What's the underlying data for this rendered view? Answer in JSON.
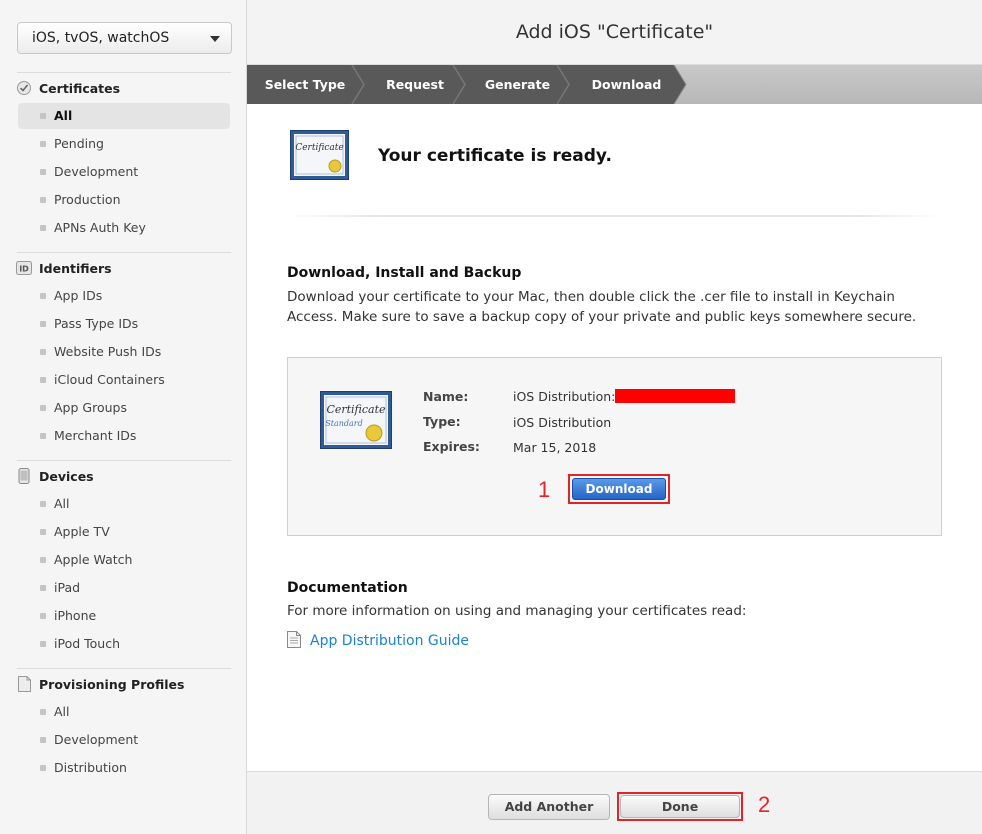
{
  "sidebar": {
    "platform_select": "iOS, tvOS, watchOS",
    "sections": [
      {
        "title": "Certificates",
        "icon": "certificate-icon",
        "items": [
          "All",
          "Pending",
          "Development",
          "Production",
          "APNs Auth Key"
        ]
      },
      {
        "title": "Identifiers",
        "icon": "id-icon",
        "icon_text": "ID",
        "items": [
          "App IDs",
          "Pass Type IDs",
          "Website Push IDs",
          "iCloud Containers",
          "App Groups",
          "Merchant IDs"
        ]
      },
      {
        "title": "Devices",
        "icon": "device-icon",
        "items": [
          "All",
          "Apple TV",
          "Apple Watch",
          "iPad",
          "iPhone",
          "iPod Touch"
        ]
      },
      {
        "title": "Provisioning Profiles",
        "icon": "document-icon",
        "items": [
          "All",
          "Development",
          "Distribution"
        ]
      }
    ],
    "active_item": "Certificates/All"
  },
  "header": {
    "title": "Add iOS \"Certificate\""
  },
  "steps": [
    "Select Type",
    "Request",
    "Generate",
    "Download"
  ],
  "content": {
    "cert_text": "Certificate",
    "cert_sub": "Standard",
    "ready_text": "Your certificate is ready.",
    "backup_heading": "Download, Install and Backup",
    "backup_para": "Download your certificate to your Mac, then double click the .cer file to install in Keychain Access. Make sure to save a backup copy of your private and public keys somewhere secure.",
    "cert_details": {
      "name_label": "Name:",
      "name_value": "iOS Distribution:",
      "type_label": "Type:",
      "type_value": "iOS Distribution",
      "expires_label": "Expires:",
      "expires_value": "Mar 15, 2018"
    },
    "download_button": "Download",
    "annotation_1": "1",
    "doc_heading": "Documentation",
    "doc_para": "For more information on using and managing your certificates read:",
    "doc_link": "App Distribution Guide"
  },
  "footer": {
    "add_another_button": "Add Another",
    "done_button": "Done",
    "annotation_2": "2"
  },
  "colors": {
    "annotation_red": "#e0242a",
    "link_blue": "#1a82d0",
    "primary_button": "#2464c8"
  }
}
